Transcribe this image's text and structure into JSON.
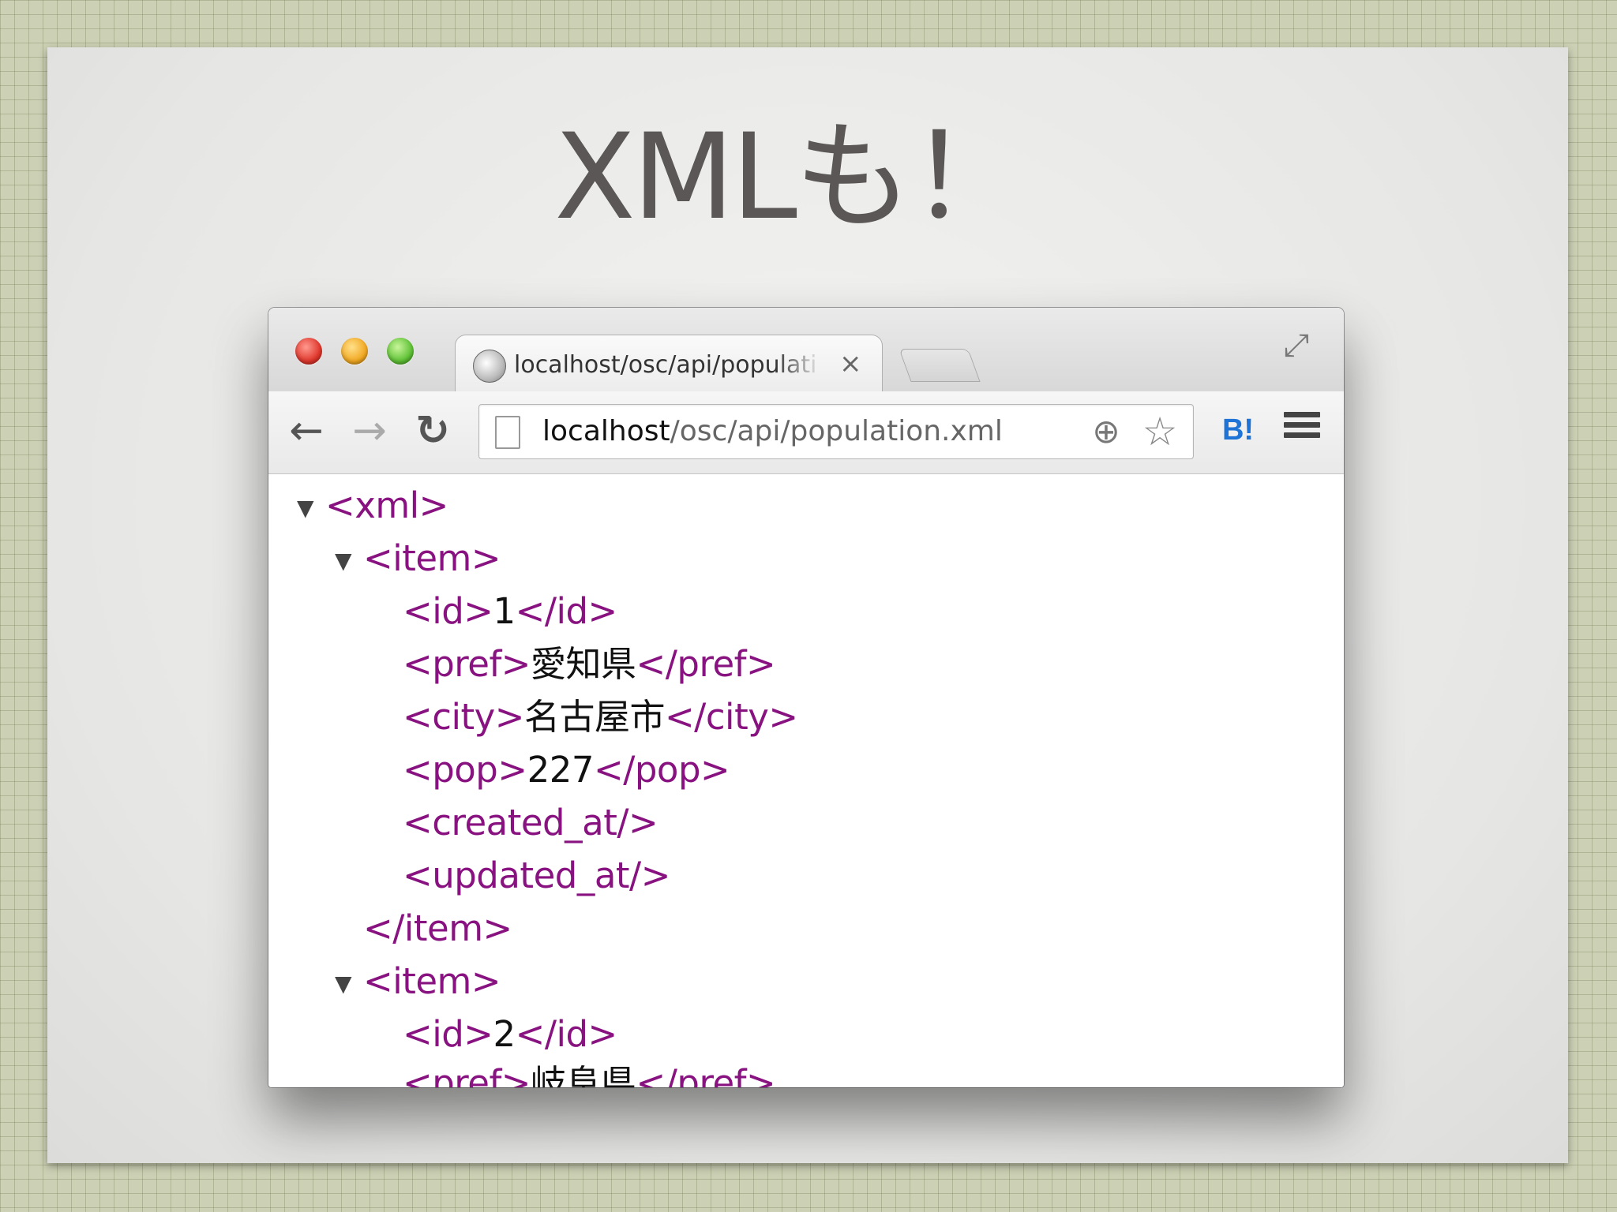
{
  "slide": {
    "title": "XMLも！"
  },
  "browser": {
    "tab": {
      "title": "localhost/osc/api/populati",
      "close_glyph": "×"
    },
    "address_bar": {
      "url_host": "localhost",
      "url_path": "/osc/api/population.xml"
    },
    "toolbar": {
      "back_glyph": "←",
      "forward_glyph": "→",
      "reload_glyph": "↻",
      "zoom_glyph": "⊕",
      "star_glyph": "☆",
      "hatena_label": "B!",
      "fullscreen_glyph": "⤢"
    },
    "xml_view": {
      "twisty_glyph": "▼",
      "lines": [
        {
          "tag_open": "<xml>"
        },
        {
          "tag_open": "<item>"
        },
        {
          "tag_open": "<id>",
          "value": "1",
          "tag_close": "</id>"
        },
        {
          "tag_open": "<pref>",
          "value": "愛知県",
          "tag_close": "</pref>"
        },
        {
          "tag_open": "<city>",
          "value": "名古屋市",
          "tag_close": "</city>"
        },
        {
          "tag_open": "<pop>",
          "value": "227",
          "tag_close": "</pop>"
        },
        {
          "tag_open": "<created_at/>"
        },
        {
          "tag_open": "<updated_at/>"
        },
        {
          "tag_open": "</item>"
        },
        {
          "tag_open": "<item>"
        },
        {
          "tag_open": "<id>",
          "value": "2",
          "tag_close": "</id>"
        },
        {
          "tag_open": "<pref>",
          "value": "岐阜県",
          "tag_close": "</pref>"
        }
      ]
    }
  }
}
